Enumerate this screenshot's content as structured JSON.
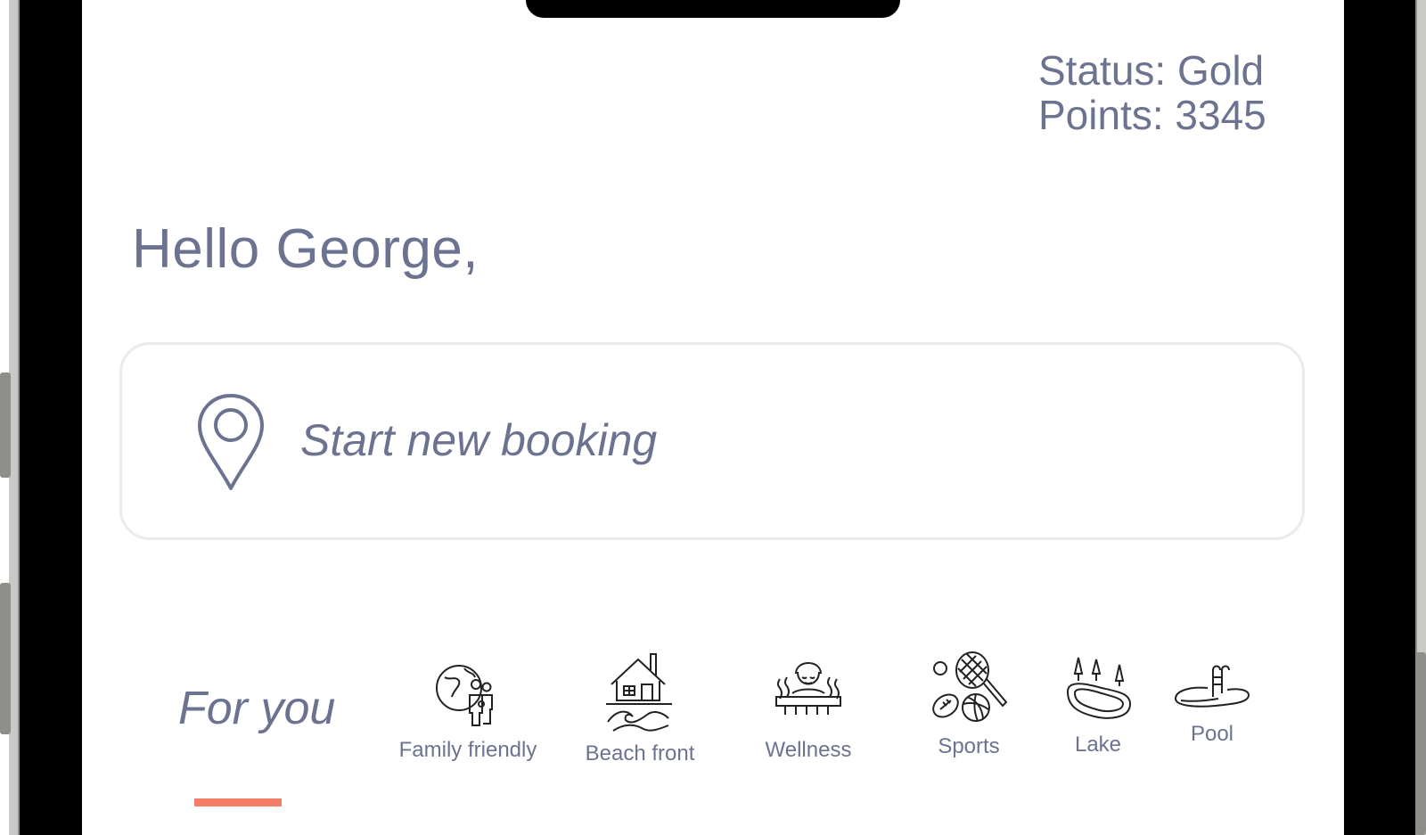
{
  "header": {
    "status_text": "Status: Gold",
    "points_text": "Points: 3345"
  },
  "greeting": "Hello George,",
  "booking": {
    "label": "Start new booking",
    "icon": "location-pin-icon"
  },
  "tabs": {
    "active_label": "For you",
    "accent_color": "#f47d67"
  },
  "categories": [
    {
      "label": "Family friendly",
      "icon": "family-globe-icon"
    },
    {
      "label": "Beach front",
      "icon": "beach-house-icon"
    },
    {
      "label": "Wellness",
      "icon": "spa-wellness-icon"
    },
    {
      "label": "Sports",
      "icon": "sports-balls-icon"
    },
    {
      "label": "Lake",
      "icon": "lake-trees-icon"
    },
    {
      "label": "Pool",
      "icon": "pool-ladder-icon"
    }
  ],
  "colors": {
    "text": "#6b7390",
    "card_border": "#ebebeb",
    "icon_stroke": "#222222"
  }
}
